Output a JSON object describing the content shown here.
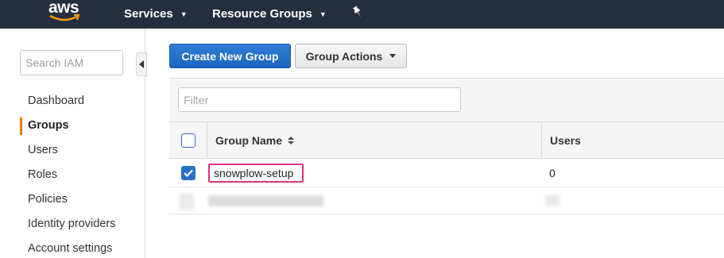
{
  "nav": {
    "logo_text": "aws",
    "services_label": "Services",
    "resource_groups_label": "Resource Groups",
    "brand_color": "#232f3e",
    "accent_color": "#ff9900"
  },
  "sidebar": {
    "search_placeholder": "Search IAM",
    "items": [
      {
        "label": "Dashboard",
        "active": false
      },
      {
        "label": "Groups",
        "active": true
      },
      {
        "label": "Users",
        "active": false
      },
      {
        "label": "Roles",
        "active": false
      },
      {
        "label": "Policies",
        "active": false
      },
      {
        "label": "Identity providers",
        "active": false
      },
      {
        "label": "Account settings",
        "active": false
      }
    ]
  },
  "toolbar": {
    "create_label": "Create New Group",
    "actions_label": "Group Actions",
    "primary_color": "#1a65bd"
  },
  "table": {
    "filter_placeholder": "Filter",
    "columns": [
      "Group Name",
      "Users"
    ],
    "rows": [
      {
        "name": "snowplow-setup",
        "users": "0",
        "checked": true
      }
    ],
    "highlight_color": "#e0317a"
  }
}
